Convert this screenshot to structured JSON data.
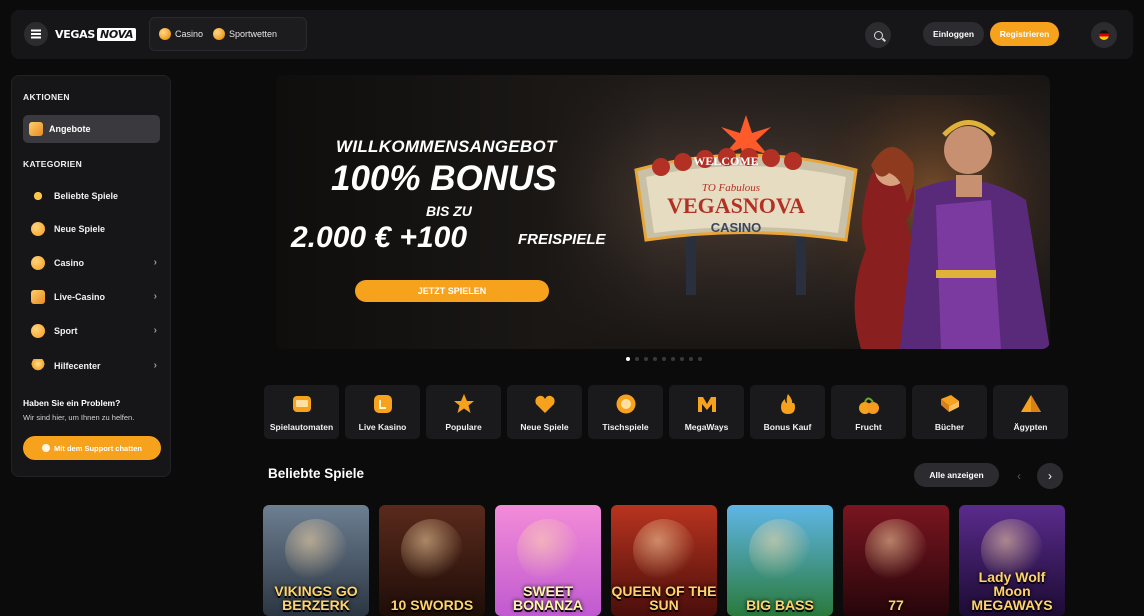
{
  "header": {
    "logo_left": "VEGAS",
    "logo_right": "NOVA",
    "nav": [
      {
        "label": "Casino"
      },
      {
        "label": "Sportwetten"
      }
    ],
    "login_label": "Einloggen",
    "register_label": "Registrieren"
  },
  "sidebar": {
    "actions_title": "AKTIONEN",
    "offers_label": "Angebote",
    "categories_title": "KATEGORIEN",
    "items": [
      {
        "label": "Beliebte Spiele",
        "icon": "star-icon"
      },
      {
        "label": "Neue Spiele",
        "icon": "heart-icon"
      },
      {
        "label": "Casino",
        "icon": "coin-icon"
      },
      {
        "label": "Live-Casino",
        "icon": "live-icon"
      },
      {
        "label": "Sport",
        "icon": "sport-icon"
      },
      {
        "label": "Hilfecenter",
        "icon": "bulb-icon"
      }
    ],
    "help_title": "Haben Sie ein Problem?",
    "help_subtitle": "Wir sind hier, um Ihnen zu helfen.",
    "support_label": "Mit dem Support chatten"
  },
  "hero": {
    "offer": "WILLKOMMENSANGEBOT",
    "bonus": "100% BONUS",
    "upto": "BIS ZU",
    "amount": "2.000 € +100",
    "spins": "FREISPIELE",
    "cta": "JETZT SPIELEN",
    "sign_welcome": "WELCOME",
    "sign_fabulous": "TO Fabulous",
    "sign_name": "VEGASNOVA",
    "sign_casino": "CASINO",
    "slides_total": 9,
    "slide_active": 1
  },
  "categories": [
    {
      "label": "Spielautomaten",
      "icon": "slot-icon"
    },
    {
      "label": "Live Kasino",
      "icon": "live-icon"
    },
    {
      "label": "Populare",
      "icon": "star-icon"
    },
    {
      "label": "Neue Spiele",
      "icon": "heart-icon"
    },
    {
      "label": "Tischspiele",
      "icon": "chip-icon"
    },
    {
      "label": "MegaWays",
      "icon": "megaways-icon"
    },
    {
      "label": "Bonus Kauf",
      "icon": "fire-icon"
    },
    {
      "label": "Frucht",
      "icon": "fruit-icon"
    },
    {
      "label": "Bücher",
      "icon": "book-icon"
    },
    {
      "label": "Ägypten",
      "icon": "pyramid-icon"
    }
  ],
  "popular": {
    "title": "Beliebte Spiele",
    "all_label": "Alle anzeigen",
    "games": [
      {
        "title": "VIKINGS GO BERZERK",
        "color_a": "#6d7f92",
        "color_b": "#2c3642"
      },
      {
        "title": "10 SWORDS",
        "color_a": "#5a2a1c",
        "color_b": "#1e0d08"
      },
      {
        "title": "SWEET BONANZA",
        "color_a": "#f38cd8",
        "color_b": "#c05ad0"
      },
      {
        "title": "QUEEN OF THE SUN",
        "color_a": "#b8341f",
        "color_b": "#4b0e0b"
      },
      {
        "title": "BIG BASS",
        "color_a": "#5fb6e6",
        "color_b": "#2a7a3c"
      },
      {
        "title": "77",
        "color_a": "#7a1520",
        "color_b": "#25060a"
      },
      {
        "title": "Lady Wolf Moon MEGAWAYS",
        "color_a": "#5a2b8c",
        "color_b": "#1c0b33"
      }
    ]
  },
  "colors": {
    "accent": "#f7a21d",
    "bg": "#0b0b0c",
    "panel": "#161618"
  }
}
